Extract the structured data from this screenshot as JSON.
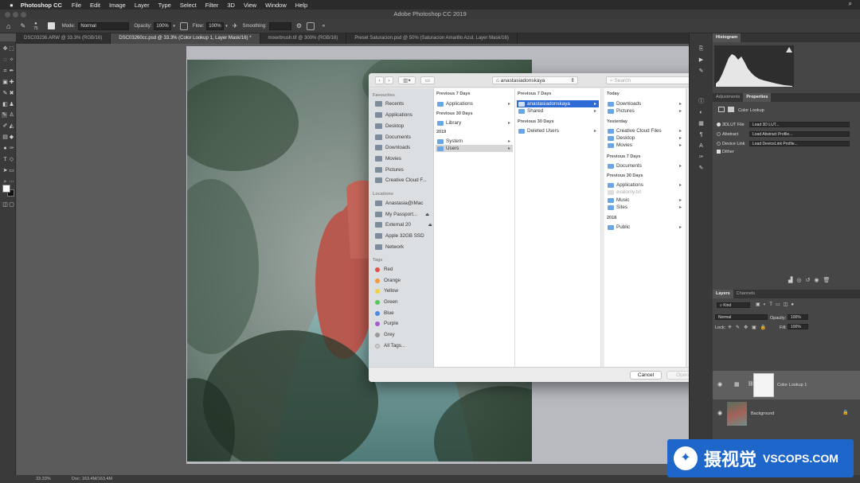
{
  "menubar": {
    "app_name": "Photoshop CC",
    "items": [
      "File",
      "Edit",
      "Image",
      "Layer",
      "Type",
      "Select",
      "Filter",
      "3D",
      "View",
      "Window",
      "Help"
    ]
  },
  "window_title": "Adobe Photoshop CC 2019",
  "options_bar": {
    "brush_size": "75",
    "mode_label": "Mode:",
    "mode_value": "Normal",
    "opacity_label": "Opacity:",
    "opacity_value": "100%",
    "flow_label": "Flow:",
    "flow_value": "100%",
    "smoothing_label": "Smoothing:"
  },
  "doc_tabs": [
    {
      "label": "DSC03236.ARW @ 33.3% (RGB/16)"
    },
    {
      "label": "DSC03260cc.psd @ 33.3% (Color Lookup 1, Layer Mask/16) *"
    },
    {
      "label": "mixerbrush.tif @ 300% (RGB/16)"
    },
    {
      "label": "Preset Saturacion.psd @ 50% (Saturacion Amarillo Azul, Layer Mask/16)"
    }
  ],
  "dialog": {
    "location": "anastasiadonskaya",
    "search_placeholder": "Search",
    "sidebar": {
      "favourites_header": "Favourites",
      "favourites": [
        "Recents",
        "Applications",
        "Desktop",
        "Documents",
        "Downloads",
        "Movies",
        "Pictures",
        "Creative Cloud F..."
      ],
      "locations_header": "Locations",
      "locations": [
        "Anastasia@iMac",
        "My Passport...",
        "External 20",
        "Apple 32GB SSD",
        "Network"
      ],
      "tags_header": "Tags",
      "tags": [
        "Red",
        "Orange",
        "Yellow",
        "Green",
        "Blue",
        "Purple",
        "Grey",
        "All Tags..."
      ]
    },
    "col1": {
      "g1": "Previous 7 Days",
      "i1": "Applications",
      "g2": "Previous 30 Days",
      "i2": "Library",
      "g3": "2019",
      "i3": "System",
      "i4": "Users"
    },
    "col2": {
      "g1": "Previous 7 Days",
      "i1": "anastasiadonskaya",
      "i2": "Shared",
      "g2": "Previous 30 Days",
      "i3": "Deleted Users"
    },
    "col3": {
      "g1": "Today",
      "i1": "Downloads",
      "i2": "Pictures",
      "g2": "Yesterday",
      "i3": "Creative Cloud Files",
      "i4": "Desktop",
      "i5": "Movies",
      "g3": "Previous 7 Days",
      "i6": "Documents",
      "g4": "Previous 30 Days",
      "i7": "Applications",
      "i8": "evalonly.txt",
      "i9": "Music",
      "i10": "Sites",
      "g5": "2018",
      "i11": "Public"
    },
    "cancel_label": "Cancel",
    "open_label": "Open"
  },
  "histogram_panel": {
    "tab": "Histogram"
  },
  "properties_panel": {
    "tabs": [
      "Adjustments",
      "Properties"
    ],
    "title": "Color Lookup",
    "row1_label": "3DLUT File",
    "row1_value": "Load 3D LUT...",
    "row2_label": "Abstract",
    "row2_value": "Load Abstract Profile...",
    "row3_label": "Device Link",
    "row3_value": "Load DeviceLink Profile...",
    "dither_label": "Dither"
  },
  "layers_panel": {
    "tabs": [
      "Layers",
      "Channels"
    ],
    "kind_value": "Kind",
    "blend_value": "Normal",
    "opacity_label": "Opacity:",
    "opacity_value": "100%",
    "lock_label": "Lock:",
    "fill_label": "Fill:",
    "fill_value": "100%",
    "layer1": "Color Lookup 1",
    "layer2": "Background"
  },
  "status": {
    "zoom": "33.33%",
    "doc": "Doc: 163.4M/163.4M"
  },
  "watermark": {
    "cn": "摄视觉",
    "en": "VSCOPS.COM"
  },
  "colors": {
    "accent": "#2f6bd6",
    "watermark": "#1e66c9",
    "folder": "#6aa6e4"
  }
}
